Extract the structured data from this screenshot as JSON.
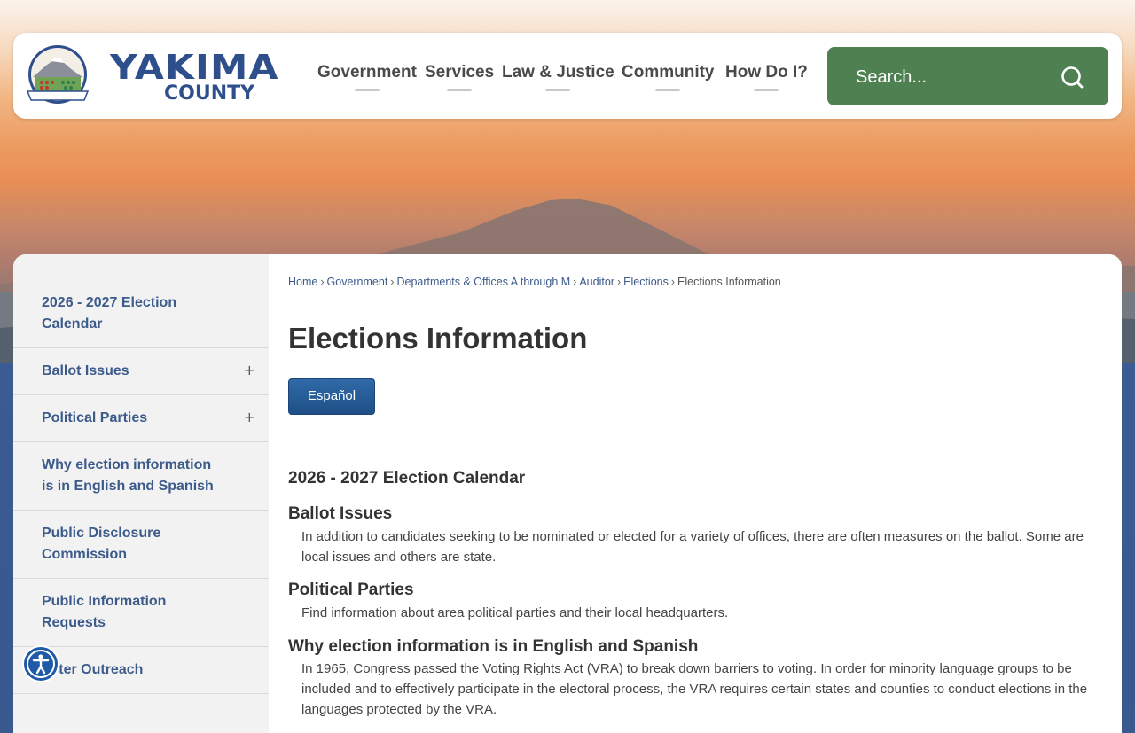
{
  "header": {
    "logo": {
      "line1": "YAKIMA",
      "line2": "COUNTY",
      "seal_text": "YAKIMA COUNTY"
    },
    "nav": [
      {
        "label": "Government"
      },
      {
        "label": "Services"
      },
      {
        "label": "Law & Justice"
      },
      {
        "label": "Community"
      },
      {
        "label": "How Do I?"
      }
    ],
    "search": {
      "placeholder": "Search...",
      "icon": "search-icon"
    }
  },
  "sidebar": {
    "items": [
      {
        "label": "2026 - 2027 Election Calendar",
        "expandable": false
      },
      {
        "label": "Ballot Issues",
        "expandable": true,
        "toggle": "+"
      },
      {
        "label": "Political Parties",
        "expandable": true,
        "toggle": "+"
      },
      {
        "label": "Why election information is in English and Spanish",
        "expandable": false
      },
      {
        "label": "Public Disclosure Commission",
        "expandable": false
      },
      {
        "label": "Public Information Requests",
        "expandable": false
      },
      {
        "label": "Voter Outreach",
        "expandable": false
      }
    ]
  },
  "breadcrumb": {
    "links": [
      "Home",
      "Government",
      "Departments & Offices A through M",
      "Auditor",
      "Elections"
    ],
    "current": "Elections Information",
    "separator": "›"
  },
  "main": {
    "title": "Elections Information",
    "espanol_button": "Español",
    "sections": [
      {
        "heading": "2026 - 2027 Election Calendar",
        "text": ""
      },
      {
        "heading": "Ballot Issues",
        "text": "In addition to candidates seeking to be nominated or elected for a variety of offices, there are often measures on the ballot. Some are local issues and others are state."
      },
      {
        "heading": "Political Parties",
        "text": "Find information about area political parties and their local headquarters."
      },
      {
        "heading": "Why election information is in English and Spanish",
        "text": "In 1965, Congress passed the Voting Rights Act (VRA) to break down barriers to voting. In order for minority language groups to be included and to effectively participate in the electoral process, the VRA requires certain states and counties to conduct elections in the languages protected by the VRA."
      }
    ]
  },
  "accessibility": {
    "icon": "accessibility-icon"
  },
  "colors": {
    "brand_blue": "#2e4e8c",
    "search_green": "#4f8051",
    "button_blue": "#1f4f86",
    "link_blue": "#3c5a8a"
  }
}
